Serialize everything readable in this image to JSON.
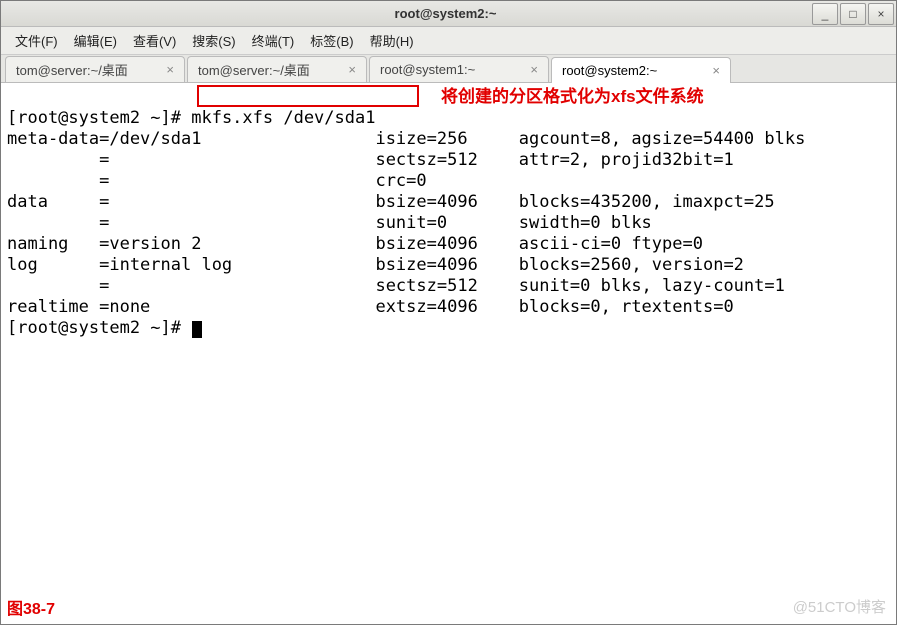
{
  "window": {
    "title": "root@system2:~"
  },
  "menu": {
    "file": "文件(F)",
    "edit": "编辑(E)",
    "view": "查看(V)",
    "search": "搜索(S)",
    "terminal": "终端(T)",
    "tabs": "标签(B)",
    "help": "帮助(H)"
  },
  "tabs": [
    {
      "label": "tom@server:~/桌面",
      "active": false
    },
    {
      "label": "tom@server:~/桌面",
      "active": false
    },
    {
      "label": "root@system1:~",
      "active": false
    },
    {
      "label": "root@system2:~",
      "active": true
    }
  ],
  "terminal": {
    "prompt1": "[root@system2 ~]# ",
    "cmd": "mkfs.xfs /dev/sda1",
    "l2a": "meta-data=/dev/sda1",
    "l2b": "isize=256",
    "l2c": "agcount=8, agsize=54400 blks",
    "l3a": "         =",
    "l3b": "sectsz=512",
    "l3c": "attr=2, projid32bit=1",
    "l4a": "         =",
    "l4b": "crc=0",
    "l5a": "data     =",
    "l5b": "bsize=4096",
    "l5c": "blocks=435200, imaxpct=25",
    "l6a": "         =",
    "l6b": "sunit=0",
    "l6c": "swidth=0 blks",
    "l7a": "naming   =version 2",
    "l7b": "bsize=4096",
    "l7c": "ascii-ci=0 ftype=0",
    "l8a": "log      =internal log",
    "l8b": "bsize=4096",
    "l8c": "blocks=2560, version=2",
    "l9a": "         =",
    "l9b": "sectsz=512",
    "l9c": "sunit=0 blks, lazy-count=1",
    "l10a": "realtime =none",
    "l10b": "extsz=4096",
    "l10c": "blocks=0, rtextents=0",
    "prompt2": "[root@system2 ~]# "
  },
  "annotations": {
    "redtext": "将创建的分区格式化为xfs文件系统",
    "figure": "图38-7",
    "watermark": "@51CTO博客"
  },
  "win_buttons": {
    "min": "_",
    "max": "□",
    "close": "×"
  }
}
